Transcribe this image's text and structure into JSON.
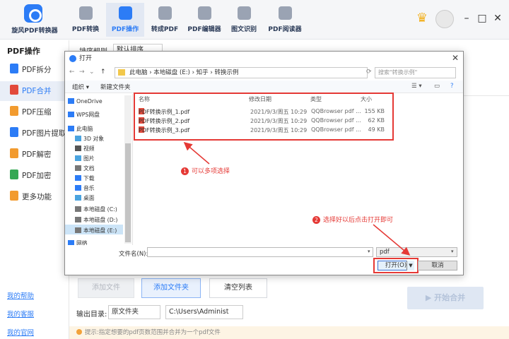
{
  "app": {
    "name": "旋风PDF转换器",
    "tabs": [
      {
        "label": "PDF转换"
      },
      {
        "label": "PDF操作"
      },
      {
        "label": "转成PDF"
      },
      {
        "label": "PDF编辑器"
      },
      {
        "label": "图文识别"
      },
      {
        "label": "PDF阅读器"
      }
    ],
    "active_tab": 1,
    "window_controls": {
      "minimize": "–",
      "maximize": "□",
      "close": "✕"
    },
    "vip_icon": "crown-icon"
  },
  "sidebar": {
    "title": "PDF操作",
    "items": [
      {
        "label": "PDF拆分",
        "color": "#2c7cf6"
      },
      {
        "label": "PDF合并",
        "color": "#e24a3b"
      },
      {
        "label": "PDF压缩",
        "color": "#f29b2f"
      },
      {
        "label": "PDF图片提取",
        "color": "#2c7cf6"
      },
      {
        "label": "PDF解密",
        "color": "#f29b2f"
      },
      {
        "label": "PDF加密",
        "color": "#34a853"
      },
      {
        "label": "更多功能",
        "color": "#f29b2f"
      }
    ],
    "active_index": 1,
    "links": [
      "我的帮助",
      "我的客服",
      "我的官网"
    ]
  },
  "main": {
    "top_partial_label": "排序规则",
    "top_partial_select": "默认排序",
    "buttons": {
      "add_file": "添加文件",
      "add_folder": "添加文件夹",
      "clear_list": "清空列表",
      "start_merge": "开始合并"
    },
    "output_dir_label": "输出目录:",
    "output_dir_option": "原文件夹",
    "output_path": "C:\\Users\\Administ",
    "tip": "提示:指定想要的pdf页数范围并合并为一个pdf文件"
  },
  "dialog": {
    "title": "打开",
    "breadcrumb": "此电脑 › 本地磁盘 (E:) › 知乎 › 转换示例",
    "search_placeholder": "搜索\"转换示例\"",
    "toolbar": {
      "organize": "组织 ▾",
      "new_folder": "新建文件夹"
    },
    "tree": [
      {
        "label": "OneDrive",
        "icon": "cloud-icon",
        "color": "#2c7cf6"
      },
      {
        "label": "WPS网盘",
        "icon": "cloud-icon",
        "color": "#2c7cf6"
      },
      {
        "label": "此电脑",
        "icon": "computer-icon",
        "color": "#2c7cf6"
      },
      {
        "label": "3D 对象",
        "icon": "cube-icon",
        "color": "#4aa3df"
      },
      {
        "label": "视频",
        "icon": "video-icon",
        "color": "#555"
      },
      {
        "label": "图片",
        "icon": "picture-icon",
        "color": "#4aa3df"
      },
      {
        "label": "文档",
        "icon": "document-icon",
        "color": "#777"
      },
      {
        "label": "下载",
        "icon": "download-icon",
        "color": "#2c7cf6"
      },
      {
        "label": "音乐",
        "icon": "music-icon",
        "color": "#2c7cf6"
      },
      {
        "label": "桌面",
        "icon": "desktop-icon",
        "color": "#4aa3df"
      },
      {
        "label": "本地磁盘 (C:)",
        "icon": "drive-icon",
        "color": "#777"
      },
      {
        "label": "本地磁盘 (D:)",
        "icon": "drive-icon",
        "color": "#777"
      },
      {
        "label": "本地磁盘 (E:)",
        "icon": "drive-icon",
        "color": "#777"
      },
      {
        "label": "网络",
        "icon": "network-icon",
        "color": "#2c7cf6"
      }
    ],
    "selected_tree_index": 12,
    "columns": [
      "名称",
      "修改日期",
      "类型",
      "大小"
    ],
    "files": [
      {
        "name": "PDF转换示例_1.pdf",
        "date": "2021/9/3/周五 10:29",
        "type": "QQBrowser pdf ...",
        "size": "155 KB"
      },
      {
        "name": "PDF转换示例_2.pdf",
        "date": "2021/9/3/周五 10:29",
        "type": "QQBrowser pdf ...",
        "size": "62 KB"
      },
      {
        "name": "PDF转换示例_3.pdf",
        "date": "2021/9/3/周五 10:29",
        "type": "QQBrowser pdf ...",
        "size": "49 KB"
      }
    ],
    "filename_label": "文件名(N):",
    "filename_value": "",
    "filetype": "pdf",
    "open_label": "打开(O)",
    "cancel_label": "取消"
  },
  "annotations": [
    {
      "num": "1",
      "text": "可以多项选择"
    },
    {
      "num": "2",
      "text": "选择好以后点击打开即可"
    }
  ]
}
